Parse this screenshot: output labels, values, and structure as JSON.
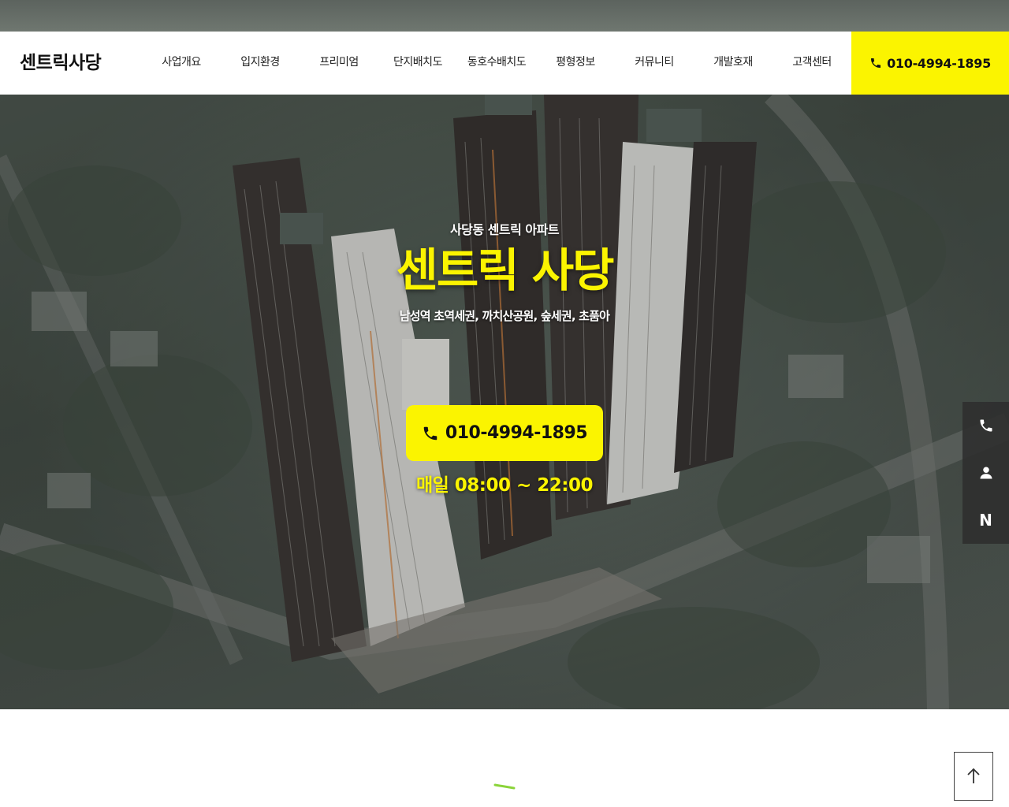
{
  "header": {
    "logo": "센트릭사당",
    "nav": [
      "사업개요",
      "입지환경",
      "프리미엄",
      "단지배치도",
      "동호수배치도",
      "평형정보",
      "커뮤니티",
      "개발호재",
      "고객센터"
    ],
    "phone": "010-4994-1895"
  },
  "hero": {
    "subtitle": "사당동 센트릭 아파트",
    "title": "센트릭 사당",
    "tagline": "남성역 초역세권, 까치산공원, 숲세권, 초품아",
    "phone": "010-4994-1895",
    "hours": "매일 08:00 ~ 22:00"
  },
  "quick_menu": {
    "items": [
      "phone-icon",
      "user-icon",
      "naver-icon"
    ],
    "naver_letter": "N"
  },
  "colors": {
    "accent": "#fbf400",
    "header_bg": "#ffffff",
    "quick_bg": "#2d2d2d",
    "loader": "#8bd43a"
  }
}
